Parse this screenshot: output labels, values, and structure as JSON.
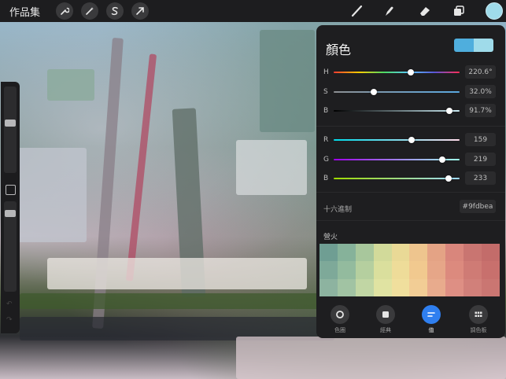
{
  "topbar": {
    "gallery_label": "作品集",
    "left_icons": [
      "wrench-icon",
      "magic-wand-icon",
      "selection-s-icon",
      "transform-arrow-icon"
    ],
    "right_icons": [
      "brush-icon",
      "smudge-icon",
      "eraser-icon",
      "layers-icon"
    ],
    "current_color": "#9fdbea"
  },
  "color_panel": {
    "title": "顏色",
    "previous_color": "#4faedd",
    "current_color": "#9fdbea",
    "hsb": [
      {
        "label": "H",
        "value": "220.6°",
        "fraction": 0.61
      },
      {
        "label": "S",
        "value": "32.0%",
        "fraction": 0.32
      },
      {
        "label": "B",
        "value": "91.7%",
        "fraction": 0.917
      }
    ],
    "rgb": [
      {
        "label": "R",
        "value": "159",
        "fraction": 0.62
      },
      {
        "label": "G",
        "value": "219",
        "fraction": 0.86
      },
      {
        "label": "B",
        "value": "233",
        "fraction": 0.91
      }
    ],
    "hex_label": "十六進制",
    "hex_value": "#9fdbea",
    "palette_label": "營火",
    "palette_colors": [
      "#6f9e93",
      "#86b29a",
      "#a8c79c",
      "#d2da9a",
      "#e9d996",
      "#eec58e",
      "#e4a385",
      "#d9867c",
      "#c97571",
      "#c36c6a",
      "#7ea999",
      "#93bb9e",
      "#b5cf9f",
      "#dadf9d",
      "#eedc99",
      "#f1c98f",
      "#e6a688",
      "#dc8a7e",
      "#cf7b75",
      "#c8706d",
      "#8db3a0",
      "#a1c3a3",
      "#c1d6a4",
      "#e0e3a2",
      "#f0df9d",
      "#f2cd95",
      "#e8ab8d",
      "#de8f84",
      "#d1807a",
      "#ca7672"
    ],
    "tabs": [
      {
        "label": "色圈",
        "icon": "color-disc-icon",
        "active": false
      },
      {
        "label": "經典",
        "icon": "classic-square-icon",
        "active": false
      },
      {
        "label": "值",
        "icon": "value-sliders-icon",
        "active": true
      },
      {
        "label": "調色板",
        "icon": "palette-grid-icon",
        "active": false
      }
    ]
  }
}
